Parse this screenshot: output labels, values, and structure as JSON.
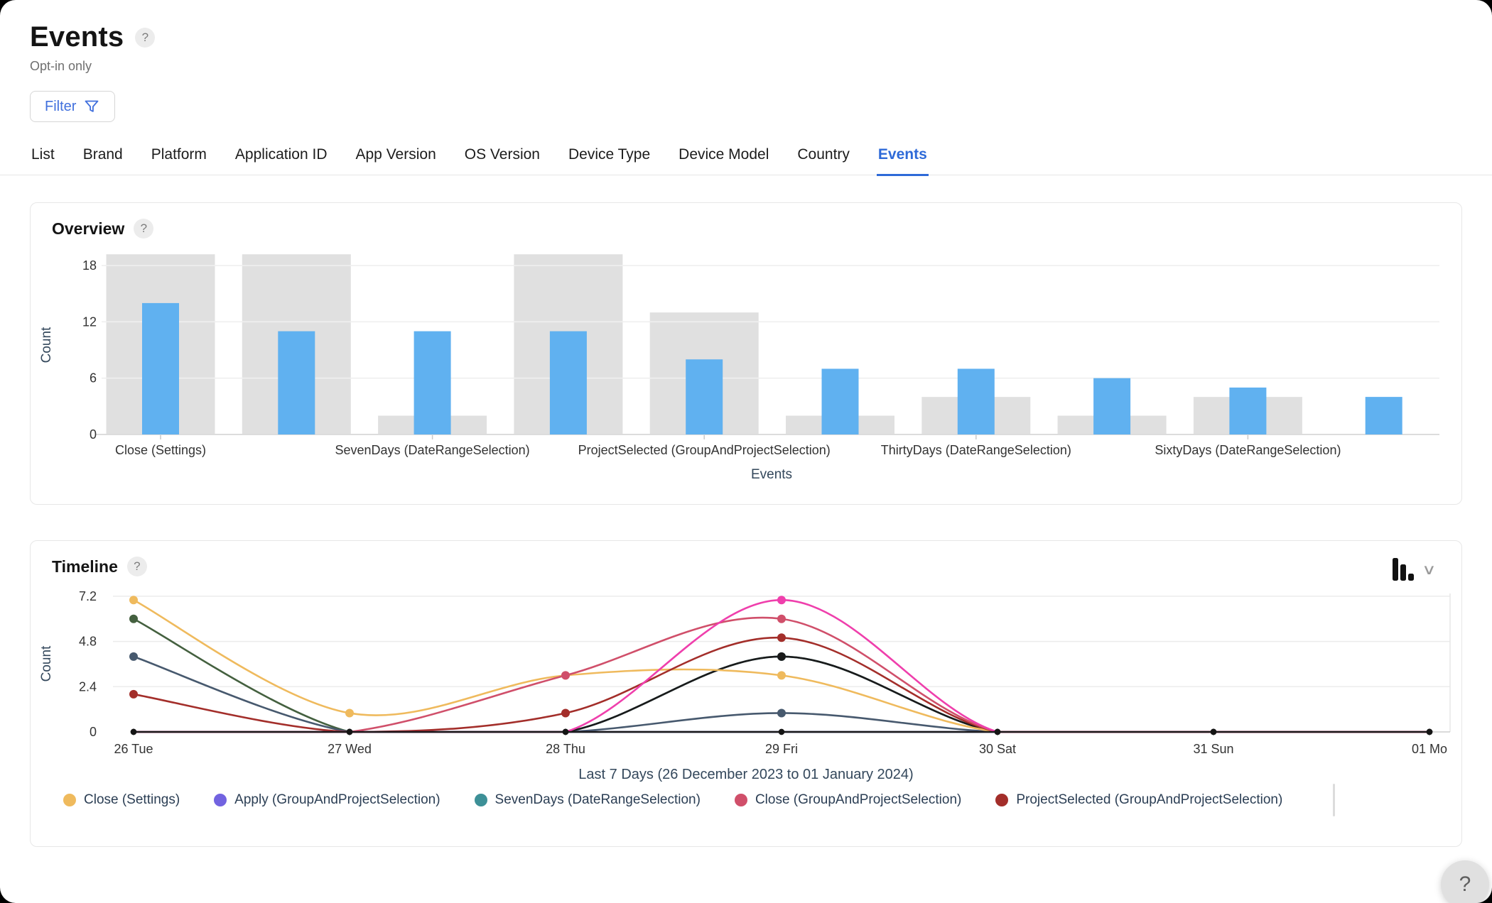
{
  "header": {
    "title": "Events",
    "help_icon": "?",
    "subtitle": "Opt-in only",
    "filter_label": "Filter"
  },
  "tabs": [
    {
      "label": "List",
      "active": false
    },
    {
      "label": "Brand",
      "active": false
    },
    {
      "label": "Platform",
      "active": false
    },
    {
      "label": "Application ID",
      "active": false
    },
    {
      "label": "App Version",
      "active": false
    },
    {
      "label": "OS Version",
      "active": false
    },
    {
      "label": "Device Type",
      "active": false
    },
    {
      "label": "Device Model",
      "active": false
    },
    {
      "label": "Country",
      "active": false
    },
    {
      "label": "Events",
      "active": true
    }
  ],
  "overview_card": {
    "title": "Overview",
    "help_icon": "?"
  },
  "timeline_card": {
    "title": "Timeline",
    "help_icon": "?",
    "chevron_icon": "⌄"
  },
  "float_help_label": "?",
  "colors": {
    "accent_blue": "#2e6ad8",
    "bar_blue": "#60b1f0",
    "bar_gray": "#e0e0e0",
    "grid": "#efefef",
    "axis_dark": "#1a1a1a",
    "tick_text": "#333333",
    "axis_title_text": "#33475b"
  },
  "chart_data": [
    {
      "type": "bar",
      "title": "Overview",
      "xlabel": "Events",
      "ylabel": "Count",
      "yticks": [
        0,
        6,
        12,
        18
      ],
      "ylim": [
        0,
        19.2
      ],
      "categories": [
        "Close (Settings)",
        "",
        "SevenDays (DateRangeSelection)",
        "",
        "ProjectSelected (GroupAndProjectSelection)",
        "",
        "ThirtyDays (DateRangeSelection)",
        "",
        "SixtyDays (DateRangeSelection)",
        ""
      ],
      "series": [
        {
          "name": "background-total",
          "color": "#e0e0e0",
          "values": [
            19.2,
            19.2,
            2,
            19.2,
            13,
            2,
            4,
            2,
            4,
            0
          ]
        },
        {
          "name": "count",
          "color": "#60b1f0",
          "values": [
            14,
            11,
            11,
            11,
            8,
            7,
            7,
            6,
            5,
            4
          ]
        }
      ],
      "note": "gray background bars of groups 1, 2 and 4 are clipped at the plot top (~19)"
    },
    {
      "type": "line",
      "title": "Timeline",
      "ylabel": "Count",
      "yticks": [
        0,
        2.4,
        4.8,
        7.2
      ],
      "ylim": [
        0,
        7.6
      ],
      "x": [
        "26 Tue",
        "27 Wed",
        "28 Thu",
        "29 Fri",
        "30 Sat",
        "31 Sun",
        "01 Mo"
      ],
      "caption": "Last 7 Days (26 December 2023 to 01 January 2024)",
      "legend": [
        {
          "label": "Close (Settings)",
          "color": "#efba5d"
        },
        {
          "label": "Apply (GroupAndProjectSelection)",
          "color": "#7263e0"
        },
        {
          "label": "SevenDays (DateRangeSelection)",
          "color": "#3d9097"
        },
        {
          "label": "Close (GroupAndProjectSelection)",
          "color": "#d04f6a"
        },
        {
          "label": "ProjectSelected (GroupAndProjectSelection)",
          "color": "#a32e2a"
        }
      ],
      "series": [
        {
          "name": "unlabeled-dark-green",
          "color": "#44603f",
          "values": [
            6,
            0,
            0,
            0,
            0,
            0,
            0
          ]
        },
        {
          "name": "unlabeled-slate",
          "color": "#47596e",
          "values": [
            4,
            0,
            0,
            1,
            0,
            0,
            0
          ]
        },
        {
          "name": "Apply (GroupAndProjectSelection)",
          "color": "#7263e0",
          "values": [
            0,
            0,
            0,
            0,
            0,
            0,
            0
          ]
        },
        {
          "name": "SevenDays (DateRangeSelection)",
          "color": "#3d9097",
          "values": [
            0,
            0,
            0,
            4,
            0,
            0,
            0
          ]
        },
        {
          "name": "unlabeled-black",
          "color": "#1a1a1a",
          "values": [
            0,
            0,
            0,
            4,
            0,
            0,
            0
          ]
        },
        {
          "name": "Close (Settings)",
          "color": "#efba5d",
          "values": [
            7,
            1,
            3,
            3,
            0,
            0,
            0
          ]
        },
        {
          "name": "ProjectSelected (GroupAndProjectSelection)",
          "color": "#a32e2a",
          "values": [
            2,
            0,
            1,
            5,
            0,
            0,
            0
          ]
        },
        {
          "name": "Close (GroupAndProjectSelection)",
          "color": "#d04f6a",
          "values": [
            0,
            0,
            3,
            6,
            0,
            0,
            0
          ]
        },
        {
          "name": "unlabeled-pink",
          "color": "#ef3fac",
          "values": [
            0,
            0,
            0,
            7,
            0,
            0,
            0
          ]
        }
      ]
    }
  ]
}
